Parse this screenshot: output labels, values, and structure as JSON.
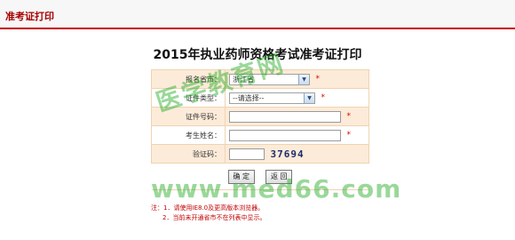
{
  "header": {
    "title": "准考证打印"
  },
  "page": {
    "title": "2015年执业药师资格考试准考证打印"
  },
  "form": {
    "province": {
      "label": "报名省市：",
      "value": "浙江省"
    },
    "id_type": {
      "label": "证件类型：",
      "value": "--请选择--"
    },
    "id_number": {
      "label": "证件号码：",
      "value": ""
    },
    "name": {
      "label": "考生姓名：",
      "value": ""
    },
    "captcha": {
      "label": "验证码：",
      "value": "",
      "code": "37694"
    },
    "required_mark": "*"
  },
  "buttons": {
    "confirm": "确 定",
    "back": "返 回"
  },
  "notes": {
    "line1": "注：1．请使用IE8.0及更高版本浏览器。",
    "line2": "2．当前未开通省市不在列表中显示。"
  },
  "watermark": {
    "text": "医学教育网",
    "url": "www.med66.com"
  },
  "colors": {
    "accent": "#c40000",
    "row_highlight": "#fcebd9",
    "watermark": "#1faa1f"
  }
}
